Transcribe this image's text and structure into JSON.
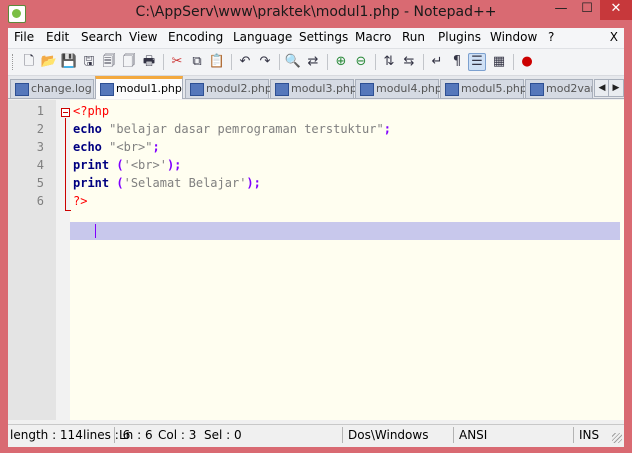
{
  "window": {
    "title": "C:\\AppServ\\www\\praktek\\modul1.php - Notepad++",
    "minimize_glyph": "—",
    "maximize_glyph": "☐",
    "close_glyph": "✕"
  },
  "menu": {
    "items": [
      "File",
      "Edit",
      "Search",
      "View",
      "Encoding",
      "Language",
      "Settings",
      "Macro",
      "Run",
      "Plugins",
      "Window",
      "?"
    ],
    "close_x": "X"
  },
  "toolbar": {
    "buttons": [
      "new-file-icon",
      "open-file-icon",
      "save-icon",
      "save-all-icon",
      "close-icon",
      "close-all-icon",
      "print-icon",
      "cut-icon",
      "copy-icon",
      "paste-icon",
      "undo-icon",
      "redo-icon",
      "find-icon",
      "replace-icon",
      "zoom-in-icon",
      "zoom-out-icon",
      "sync-vertical-icon",
      "sync-horizontal-icon",
      "word-wrap-icon",
      "show-all-chars-icon",
      "indent-guide-icon",
      "user-language-icon",
      "record-macro-icon"
    ],
    "active": [
      "indent-guide-icon"
    ]
  },
  "tabs": {
    "items": [
      {
        "label": "change.log",
        "active": false
      },
      {
        "label": "modul1.php",
        "active": true
      },
      {
        "label": "modul2.php",
        "active": false
      },
      {
        "label": "modul3.php",
        "active": false
      },
      {
        "label": "modul4.php",
        "active": false
      },
      {
        "label": "modul5.php",
        "active": false
      },
      {
        "label": "mod2vara",
        "active": false
      }
    ],
    "scroll_left": "◀",
    "scroll_right": "▶"
  },
  "editor": {
    "line_numbers": [
      "1",
      "2",
      "3",
      "4",
      "5",
      "6"
    ],
    "current_line": 6,
    "lines": [
      {
        "tokens": [
          {
            "t": "<?php",
            "c": "tag"
          }
        ]
      },
      {
        "tokens": [
          {
            "t": "echo",
            "c": "kw"
          },
          {
            "t": " ",
            "c": ""
          },
          {
            "t": "\"belajar dasar pemrograman terstuktur\"",
            "c": "str"
          },
          {
            "t": ";",
            "c": "op"
          }
        ]
      },
      {
        "tokens": [
          {
            "t": "echo",
            "c": "kw"
          },
          {
            "t": " ",
            "c": ""
          },
          {
            "t": "\"<br>\"",
            "c": "str"
          },
          {
            "t": ";",
            "c": "op"
          }
        ]
      },
      {
        "tokens": [
          {
            "t": "print",
            "c": "kw"
          },
          {
            "t": " ",
            "c": ""
          },
          {
            "t": "(",
            "c": "op"
          },
          {
            "t": "'<br>'",
            "c": "str"
          },
          {
            "t": ");",
            "c": "op"
          }
        ]
      },
      {
        "tokens": [
          {
            "t": "print",
            "c": "kw"
          },
          {
            "t": " ",
            "c": ""
          },
          {
            "t": "(",
            "c": "op"
          },
          {
            "t": "'Selamat Belajar'",
            "c": "str"
          },
          {
            "t": ");",
            "c": "op"
          }
        ]
      },
      {
        "tokens": [
          {
            "t": "?>",
            "c": "tag"
          }
        ]
      }
    ]
  },
  "status": {
    "length": "length : 114",
    "lines": "lines : 6",
    "ln": "Ln : 6",
    "col": "Col : 3",
    "sel": "Sel : 0",
    "eol": "Dos\\Windows",
    "encoding": "ANSI",
    "mode": "INS"
  },
  "colors": {
    "window_frame": "#d96a72",
    "active_tab_accent": "#f3a93f",
    "current_line": "#c8c8ec",
    "keyword": "#000080",
    "string": "#808080",
    "php_tag": "#ff0000"
  }
}
